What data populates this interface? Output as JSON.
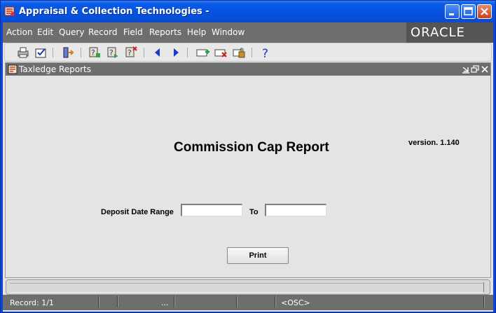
{
  "window": {
    "title": "Appraisal & Collection Technologies -"
  },
  "menu": {
    "items": [
      "Action",
      "Edit",
      "Query",
      "Record",
      "Field",
      "Reports",
      "Help",
      "Window"
    ],
    "brand": "ORACLE"
  },
  "toolbar": {
    "icons": [
      "print-icon",
      "save-icon",
      "exit-icon",
      "enter-query-icon",
      "execute-query-icon",
      "cancel-query-icon",
      "previous-record-icon",
      "next-record-icon",
      "insert-record-icon",
      "delete-record-icon",
      "lock-record-icon",
      "help-icon"
    ]
  },
  "form": {
    "window_title": "Taxledge Reports",
    "report_title": "Commission Cap Report",
    "version": "version. 1.140",
    "deposit_label": "Deposit Date Range",
    "to_label": "To",
    "from_value": "",
    "to_value": "",
    "print_label": "Print"
  },
  "status": {
    "record": "Record: 1/1",
    "ellipsis": "...",
    "mode": "<OSC>"
  },
  "colors": {
    "titlebar": "#0a5ae8",
    "menubar": "#6e6e6e",
    "canvas": "#e4e4e4"
  }
}
